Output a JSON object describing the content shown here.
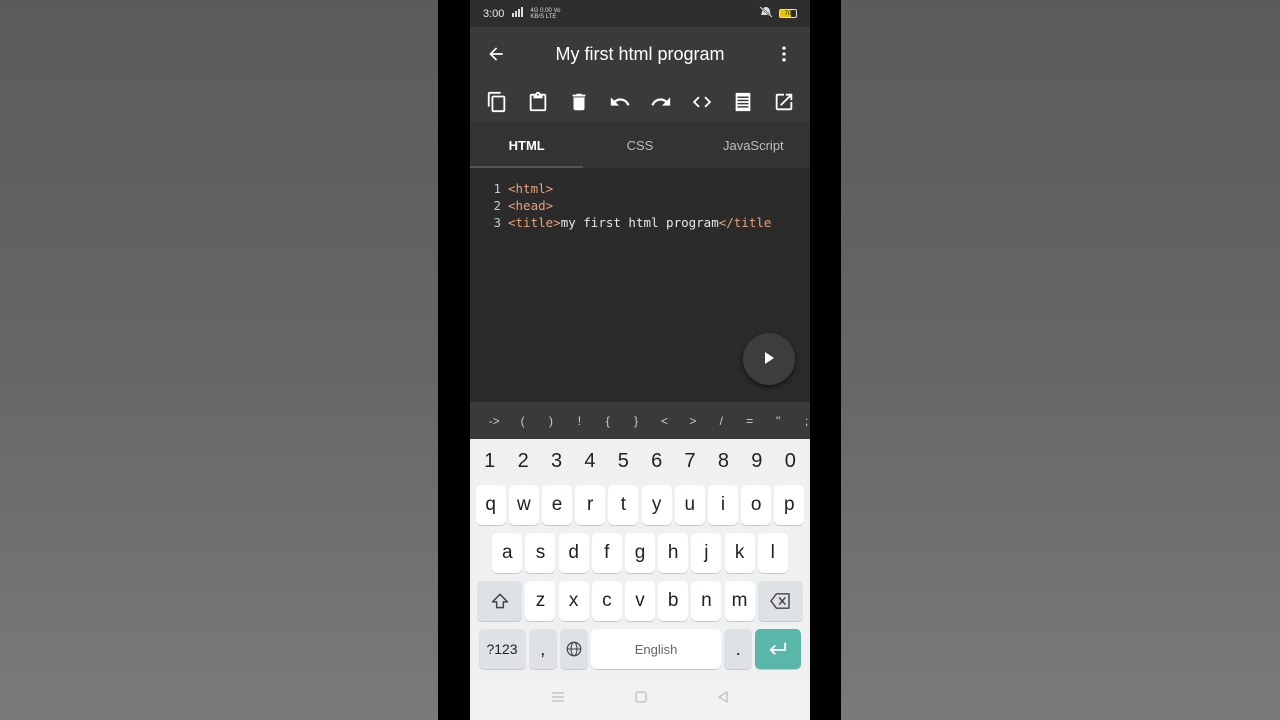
{
  "status": {
    "time": "3:00",
    "net_top": "4G  0.00 Vo",
    "net_bottom": "KB/S LTE",
    "battery": "70"
  },
  "app_bar": {
    "title": "My first html program"
  },
  "toolbar": {
    "icons": [
      "copy-icon",
      "paste-icon",
      "delete-icon",
      "undo-icon",
      "redo-icon",
      "code-icon",
      "document-icon",
      "open-external-icon"
    ]
  },
  "tabs": [
    {
      "label": "HTML",
      "active": true
    },
    {
      "label": "CSS",
      "active": false
    },
    {
      "label": "JavaScript",
      "active": false
    }
  ],
  "editor": {
    "lines": [
      {
        "n": "1",
        "tag": "<html>",
        "text": "",
        "close": ""
      },
      {
        "n": "2",
        "tag": "<head>",
        "text": "",
        "close": ""
      },
      {
        "n": "3",
        "tag": "<title>",
        "text": "my first html program",
        "close": "</title"
      }
    ]
  },
  "symbols": [
    "->",
    "(",
    ")",
    "!",
    "{",
    "}",
    "<",
    ">",
    "/",
    "=",
    "\"",
    ";"
  ],
  "keyboard": {
    "numbers": [
      "1",
      "2",
      "3",
      "4",
      "5",
      "6",
      "7",
      "8",
      "9",
      "0"
    ],
    "row1": [
      "q",
      "w",
      "e",
      "r",
      "t",
      "y",
      "u",
      "i",
      "o",
      "p"
    ],
    "row2": [
      "a",
      "s",
      "d",
      "f",
      "g",
      "h",
      "j",
      "k",
      "l"
    ],
    "row3": [
      "z",
      "x",
      "c",
      "v",
      "b",
      "n",
      "m"
    ],
    "sym_label": "?123",
    "comma": ",",
    "space_label": "English",
    "period": "."
  },
  "colors": {
    "accent": "#5bb6aa",
    "tag": "#e8a27a"
  }
}
